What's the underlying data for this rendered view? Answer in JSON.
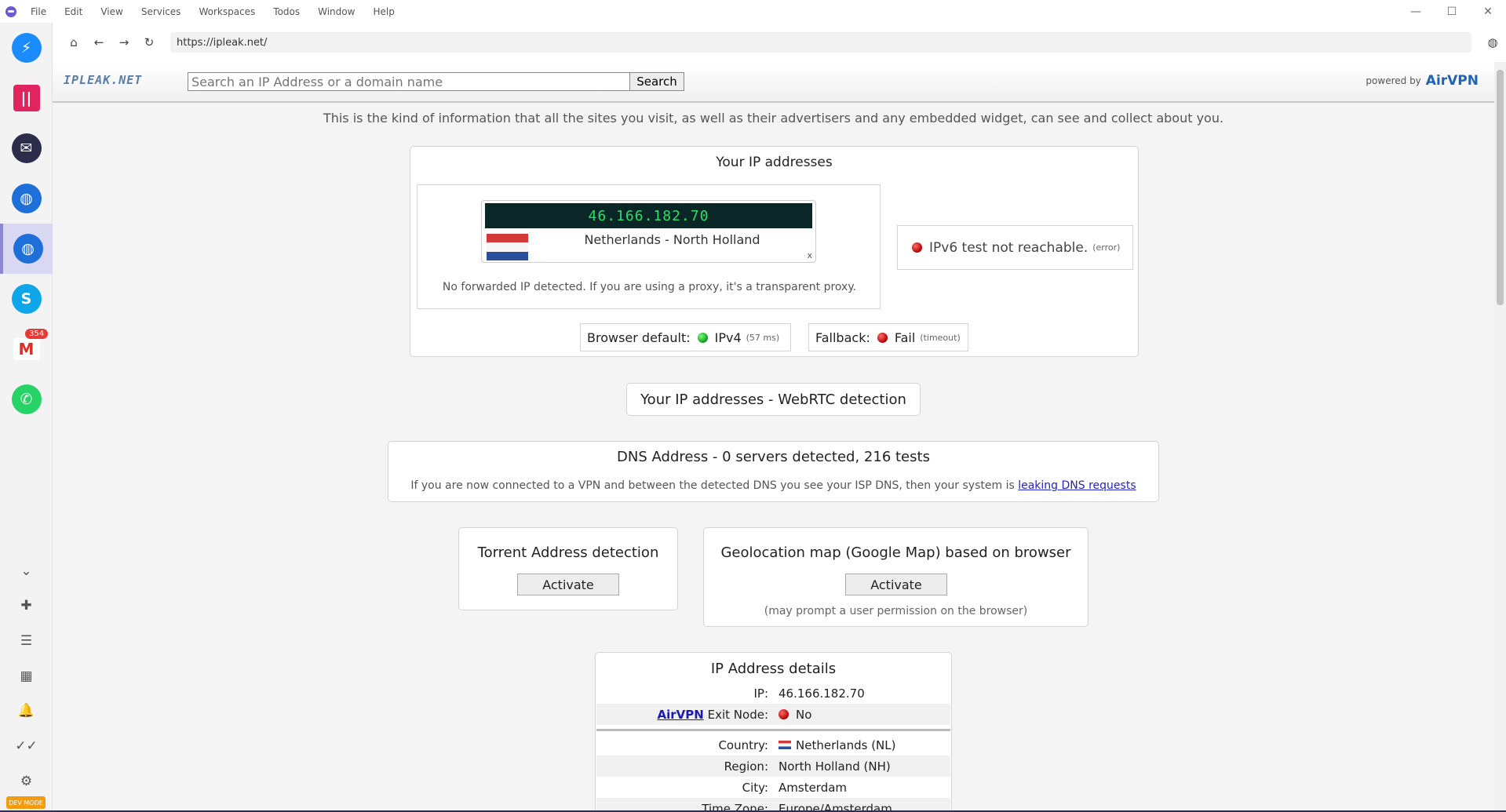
{
  "window": {
    "menu": [
      "File",
      "Edit",
      "View",
      "Services",
      "Workspaces",
      "Todos",
      "Window",
      "Help"
    ],
    "controls": {
      "minimize": "—",
      "maximize": "☐",
      "close": "✕"
    }
  },
  "sidebar": {
    "services": [
      {
        "name": "messenger",
        "glyph": "⚡",
        "icon": "messenger-icon"
      },
      {
        "name": "hook",
        "glyph": "||",
        "icon": "hook-icon"
      },
      {
        "name": "proton",
        "glyph": "✉",
        "icon": "proton-mail-icon"
      },
      {
        "name": "web-1",
        "glyph": "◍",
        "icon": "globe-icon"
      },
      {
        "name": "web-2",
        "glyph": "◍",
        "icon": "globe-icon"
      },
      {
        "name": "skype",
        "glyph": "S",
        "icon": "skype-icon"
      },
      {
        "name": "gmail",
        "glyph": "M",
        "icon": "gmail-icon",
        "badge": "354"
      },
      {
        "name": "whatsapp",
        "glyph": "✆",
        "icon": "whatsapp-icon"
      }
    ],
    "tools": [
      "⌄",
      "✚",
      "☰",
      "▦",
      "🔔",
      "✓✓",
      "⚙"
    ],
    "devmode": "DEV MODE"
  },
  "navbar": {
    "url": "https://ipleak.net/",
    "glyphs": {
      "home": "⌂",
      "back": "←",
      "forward": "→",
      "reload": "↻",
      "ext": "◍"
    }
  },
  "site": {
    "logo": "IPLEAK.NET",
    "search_placeholder": "Search an IP Address or a domain name",
    "search_button": "Search",
    "powered_by": "powered by",
    "powered_brand": "AirVPN",
    "intro": "This is the kind of information that all the sites you visit, as well as their advertisers and any embedded widget, can see and collect about you."
  },
  "ip_card": {
    "title": "Your IP addresses",
    "ip": "46.166.182.70",
    "location": "Netherlands - North Holland",
    "close": "x",
    "forward_note": "No forwarded IP detected. If you are using a proxy, it's a transparent proxy.",
    "ipv6_text": "IPv6 test not reachable.",
    "ipv6_note": "(error)",
    "browser_default_label": "Browser default:",
    "browser_default_value": "IPv4",
    "browser_default_note": "(57 ms)",
    "fallback_label": "Fallback:",
    "fallback_value": "Fail",
    "fallback_note": "(timeout)"
  },
  "webrtc": {
    "title": "Your IP addresses - WebRTC detection"
  },
  "dns": {
    "title": "DNS Address - 0 servers detected, 216 tests",
    "note": "If you are now connected to a VPN and between the detected DNS you see your ISP DNS, then your system is",
    "link": "leaking DNS requests"
  },
  "torrent": {
    "title": "Torrent Address detection",
    "button": "Activate"
  },
  "geo": {
    "title": "Geolocation map (Google Map) based on browser",
    "button": "Activate",
    "note": "(may prompt a user permission on the browser)"
  },
  "details": {
    "title": "IP Address details",
    "ip_label": "IP:",
    "ip_value": "46.166.182.70",
    "exit_link": "AirVPN",
    "exit_label": "Exit Node:",
    "exit_value": "No",
    "country_label": "Country:",
    "country_value": "Netherlands (NL)",
    "region_label": "Region:",
    "region_value": "North Holland (NH)",
    "city_label": "City:",
    "city_value": "Amsterdam",
    "tz_label": "Time Zone:",
    "tz_value": "Europe/Amsterdam"
  }
}
